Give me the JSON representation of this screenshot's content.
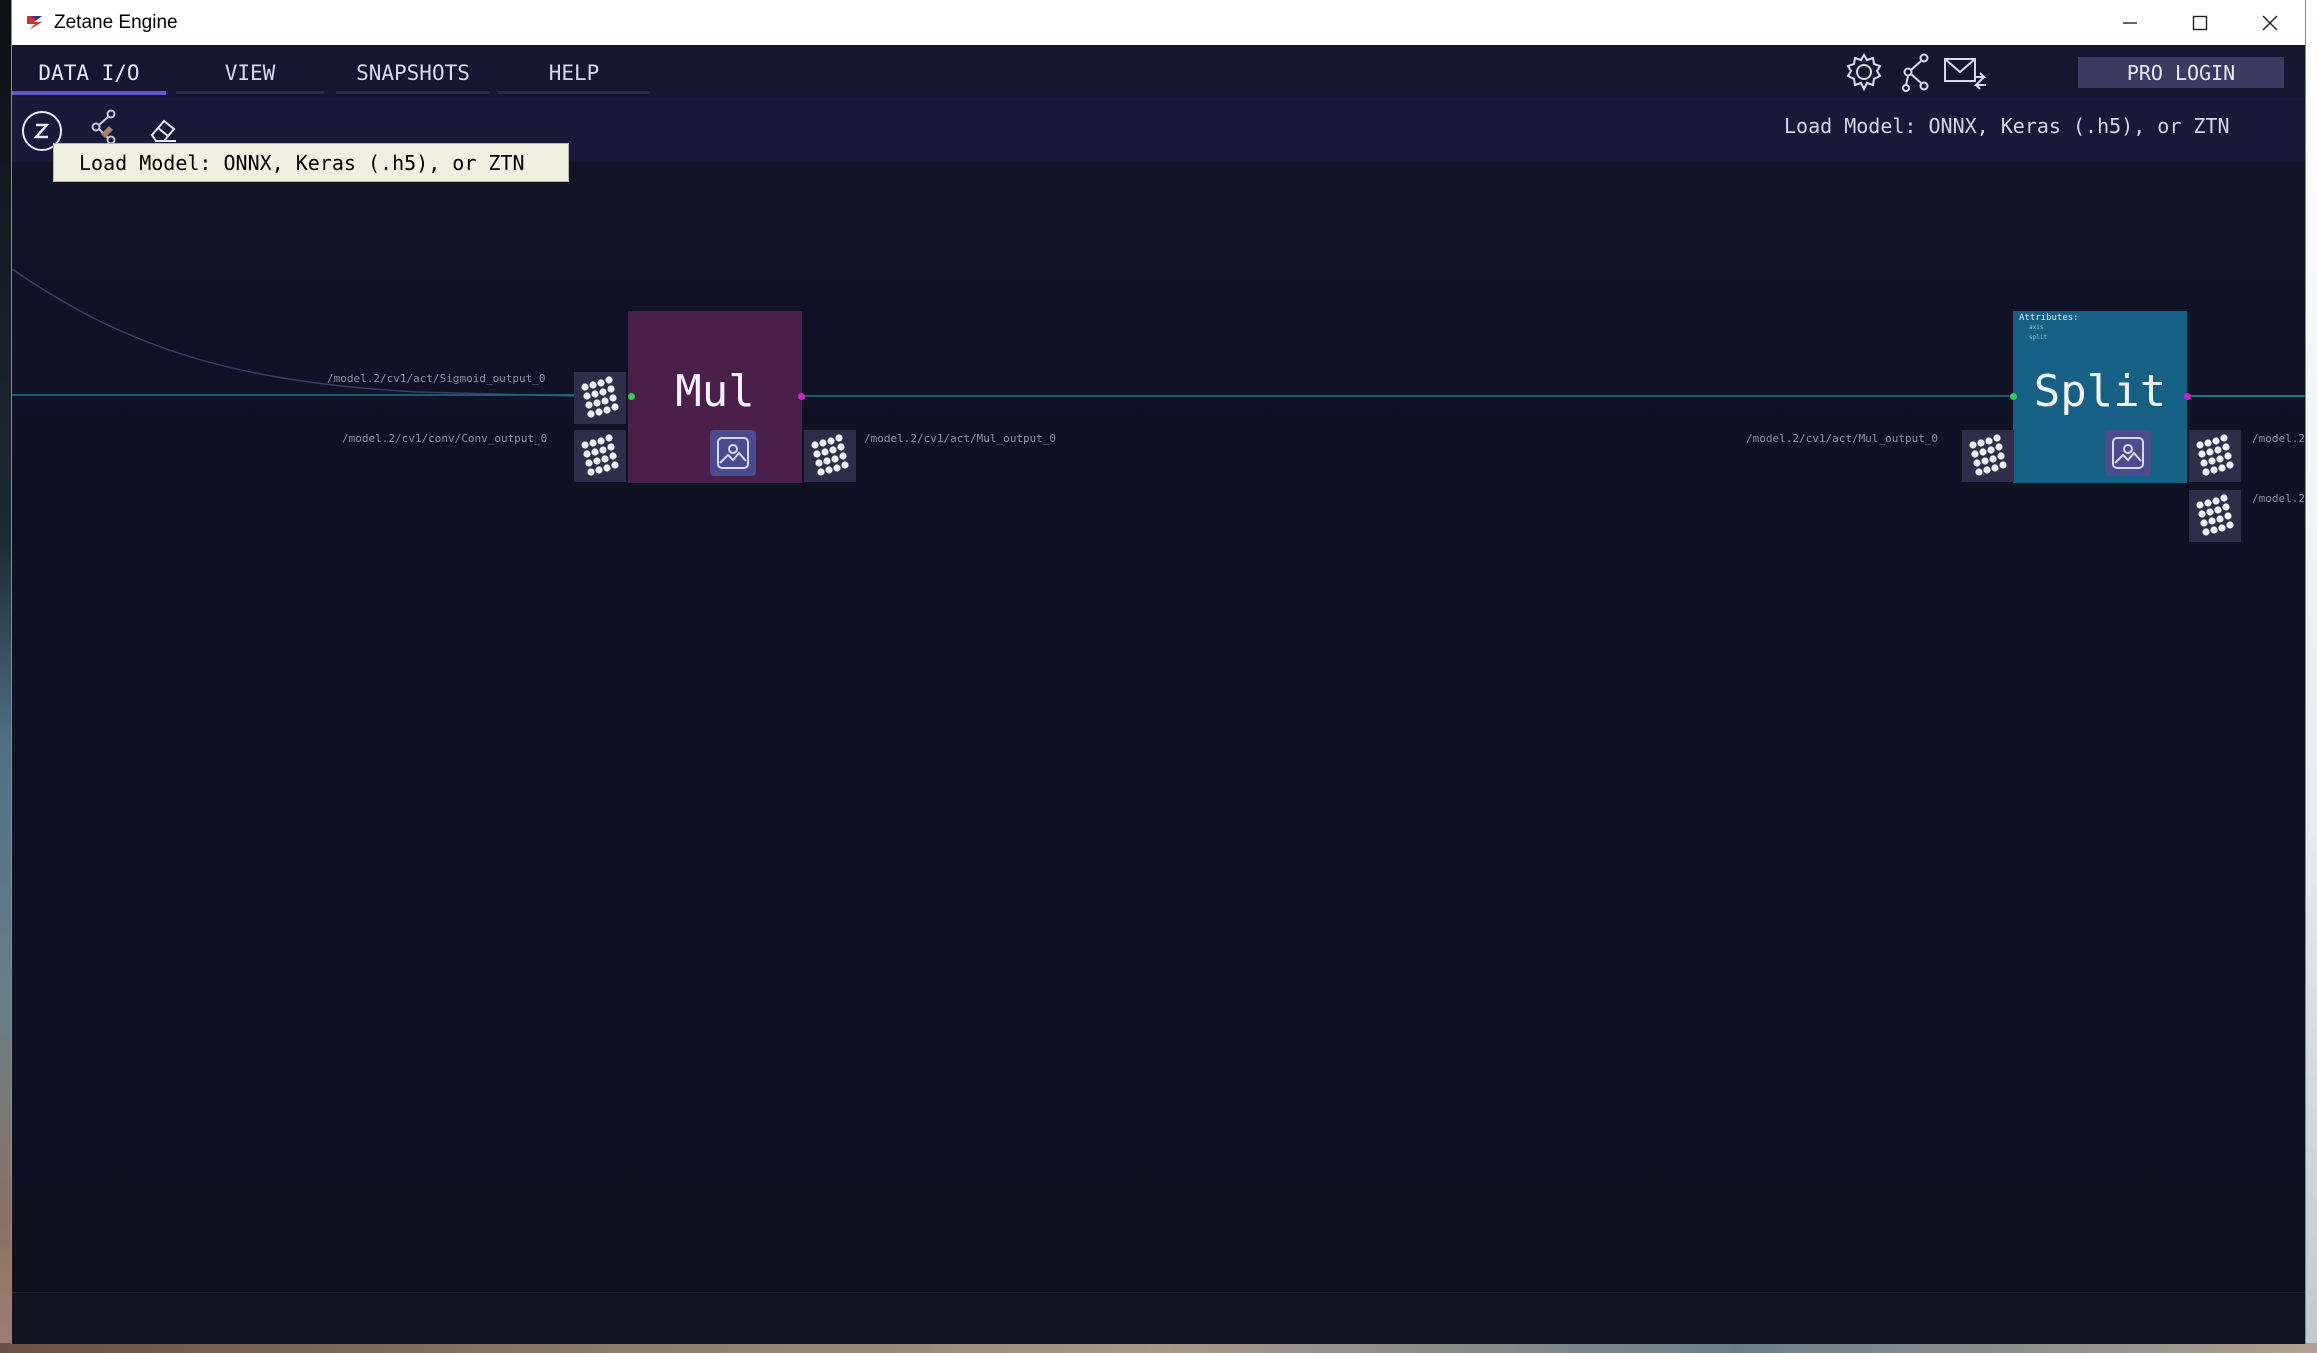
{
  "window": {
    "title": "Zetane Engine"
  },
  "menu": {
    "tabs": [
      {
        "label": "DATA I/O",
        "active": true
      },
      {
        "label": "VIEW",
        "active": false
      },
      {
        "label": "SNAPSHOTS",
        "active": false
      },
      {
        "label": "HELP",
        "active": false
      }
    ],
    "icons": [
      "gear-icon",
      "graph-icon",
      "mail-icon"
    ],
    "pro_login": "PRO LOGIN"
  },
  "toolbar": {
    "icons": [
      "zetane-logo-icon",
      "load-model-icon",
      "eraser-icon"
    ],
    "status": "Load Model: ONNX, Keras (.h5), or ZTN",
    "tooltip": "Load Model: ONNX, Keras (.h5), or ZTN"
  },
  "graph": {
    "nodes": [
      {
        "title": "Mul",
        "color": "#4a1f4a"
      },
      {
        "title": "Split",
        "color": "#166085",
        "attributes_label": "Attributes:",
        "attributes_sub": [
          "axis",
          "split"
        ]
      }
    ],
    "edge_labels": {
      "mul_input_top": "/model.2/cv1/act/Sigmoid_output_0",
      "mul_input_bottom": "/model.2/cv1/conv/Conv_output_0",
      "mul_output": "/model.2/cv1/act/Mul_output_0",
      "split_input": "/model.2/cv1/act/Mul_output_0",
      "split_output_1": "/model.2",
      "split_output_2": "/model.2"
    },
    "colors": {
      "edge": "#1f8fa8",
      "input_dot": "#33cc55",
      "output_dot": "#cc22cc"
    }
  }
}
